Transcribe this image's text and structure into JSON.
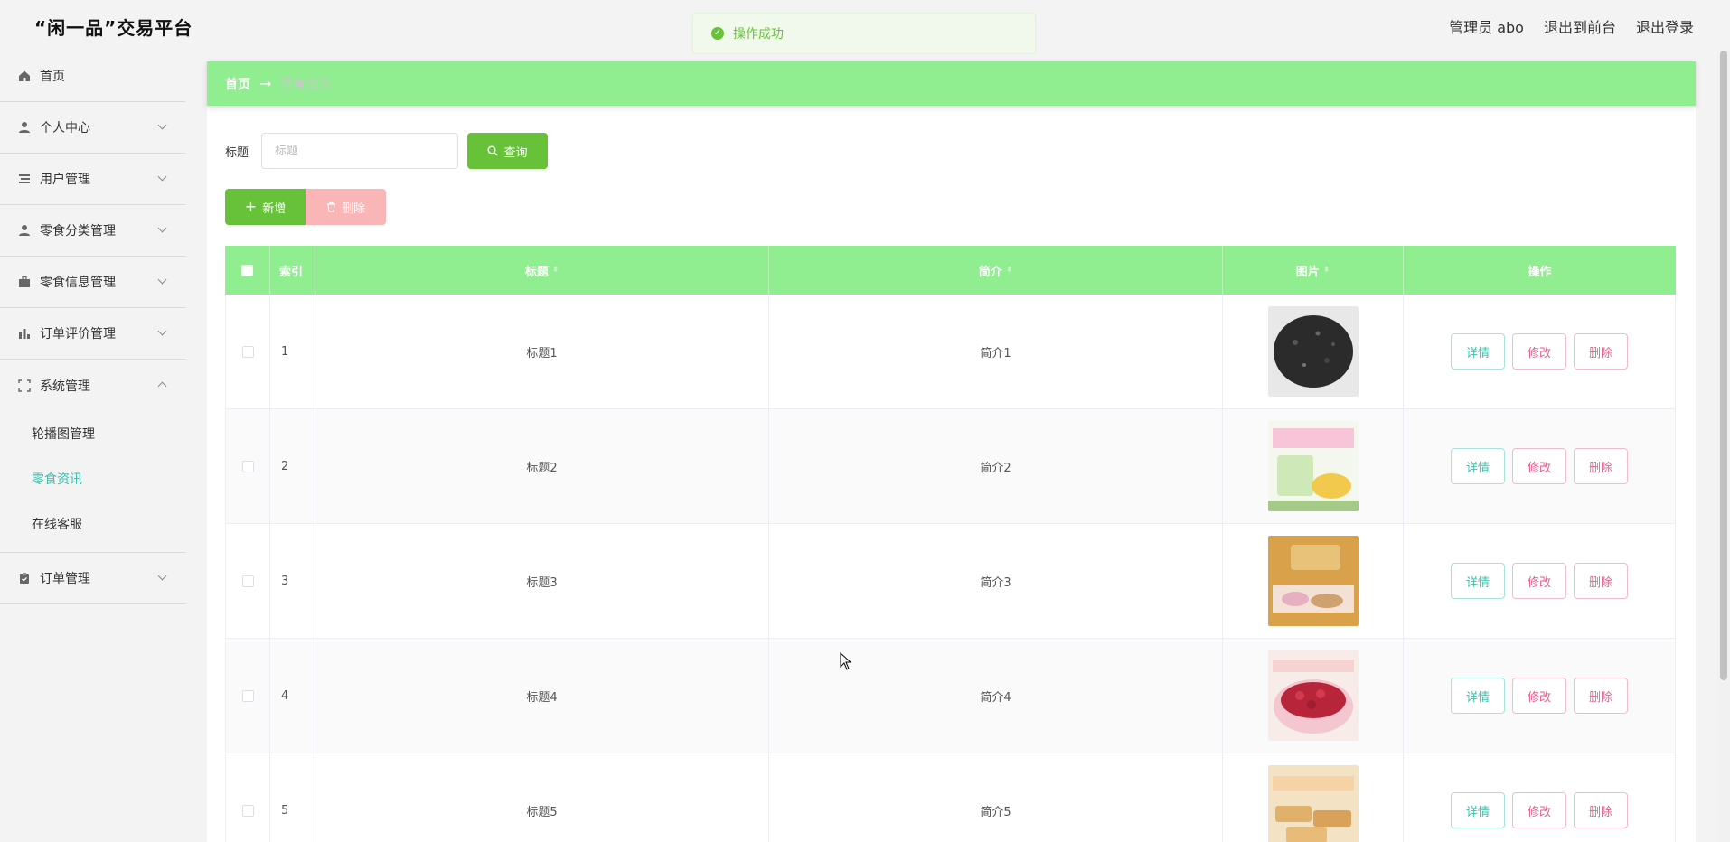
{
  "header": {
    "brand": "“闲一品”交易平台",
    "user": "管理员 abo",
    "to_front": "退出到前台",
    "logout": "退出登录"
  },
  "toast": {
    "text": "操作成功"
  },
  "sidebar": {
    "items": [
      {
        "label": "首页",
        "icon": "home-icon"
      },
      {
        "label": "个人中心",
        "icon": "user-icon"
      },
      {
        "label": "用户管理",
        "icon": "list-icon"
      },
      {
        "label": "零食分类管理",
        "icon": "user-icon"
      },
      {
        "label": "零食信息管理",
        "icon": "briefcase-icon"
      },
      {
        "label": "订单评价管理",
        "icon": "chart-icon"
      },
      {
        "label": "系统管理",
        "icon": "fullscreen-icon"
      },
      {
        "label": "订单管理",
        "icon": "clipboard-icon"
      }
    ],
    "sub_items": [
      "轮播图管理",
      "零食资讯",
      "在线客服"
    ]
  },
  "breadcrumb": {
    "home": "首页",
    "current": "零食资讯"
  },
  "search": {
    "label": "标题",
    "placeholder": "标题",
    "button": "查询"
  },
  "actions": {
    "add": "新增",
    "delete": "删除"
  },
  "table": {
    "headers": [
      "索引",
      "标题",
      "简介",
      "图片",
      "操作"
    ],
    "rows": [
      {
        "index": "1",
        "title": "标题1",
        "intro": "简介1"
      },
      {
        "index": "2",
        "title": "标题2",
        "intro": "简介2"
      },
      {
        "index": "3",
        "title": "标题3",
        "intro": "简介3"
      },
      {
        "index": "4",
        "title": "标题4",
        "intro": "简介4"
      },
      {
        "index": "5",
        "title": "标题5",
        "intro": "简介5"
      }
    ],
    "op_labels": {
      "detail": "详情",
      "edit": "修改",
      "delete": "删除"
    }
  },
  "colors": {
    "accent_green": "#90ee90",
    "button_green": "#67c23a",
    "active_teal": "#3cc0ad",
    "danger_pink": "#e85a8a"
  }
}
